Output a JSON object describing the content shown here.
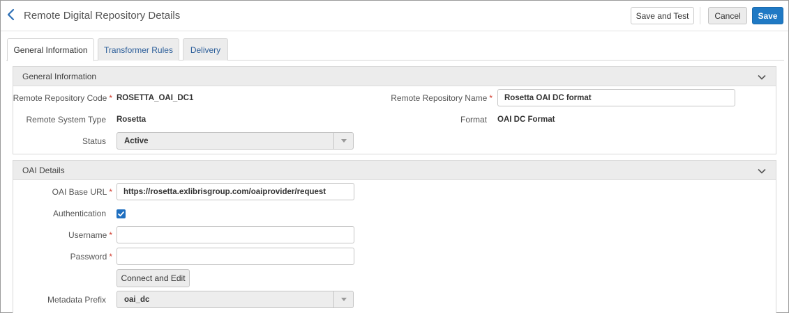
{
  "header": {
    "title": "Remote Digital Repository Details",
    "save_and_test": "Save and Test",
    "cancel": "Cancel",
    "save": "Save"
  },
  "tabs": [
    {
      "label": "General Information",
      "active": true
    },
    {
      "label": "Transformer Rules",
      "active": false
    },
    {
      "label": "Delivery",
      "active": false
    }
  ],
  "general": {
    "title": "General Information",
    "code_label": "Remote Repository Code",
    "code_value": "ROSETTA_OAI_DC1",
    "name_label": "Remote Repository Name",
    "name_value": "Rosetta OAI DC format",
    "system_type_label": "Remote System Type",
    "system_type_value": "Rosetta",
    "format_label": "Format",
    "format_value": "OAI DC Format",
    "status_label": "Status",
    "status_value": "Active"
  },
  "oai": {
    "title": "OAI Details",
    "base_url_label": "OAI Base URL",
    "base_url_value": "https://rosetta.exlibrisgroup.com/oaiprovider/request",
    "auth_label": "Authentication",
    "auth_checked": true,
    "username_label": "Username",
    "username_value": "",
    "password_label": "Password",
    "password_value": "",
    "connect_button": "Connect and Edit",
    "prefix_label": "Metadata Prefix",
    "prefix_value": "oai_dc"
  },
  "required_marker": "*",
  "colors": {
    "primary": "#1f79c4",
    "link": "#2d5f9a",
    "required": "#d0392b"
  }
}
